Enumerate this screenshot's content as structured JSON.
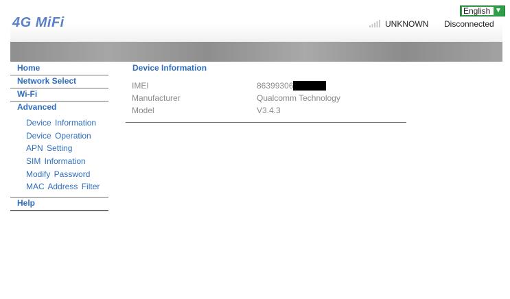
{
  "header": {
    "logo_text": "4G MiFi",
    "language": {
      "selected": "English"
    },
    "network_type": "UNKNOWN",
    "connection_status": "Disconnected",
    "signal_icon": "signal-bars-icon"
  },
  "nav": {
    "home": "Home",
    "network_select": "Network Select",
    "wifi": "Wi-Fi",
    "advanced": "Advanced",
    "advanced_items": [
      "Device Information",
      "Device Operation",
      "APN Setting",
      "SIM Information",
      "Modify Password",
      "MAC Address Filter"
    ],
    "help": "Help"
  },
  "main": {
    "section_title": "Device Information",
    "rows": [
      {
        "label": "IMEI",
        "value": "86399306"
      },
      {
        "label": "Manufacturer",
        "value": "Qualcomm Technology"
      },
      {
        "label": "Model",
        "value": "V3.4.3"
      }
    ]
  },
  "colors": {
    "link": "#2f6ebf",
    "logo": "#5b82c8",
    "select_border": "#2e9f47",
    "label": "#8a8a8a"
  }
}
